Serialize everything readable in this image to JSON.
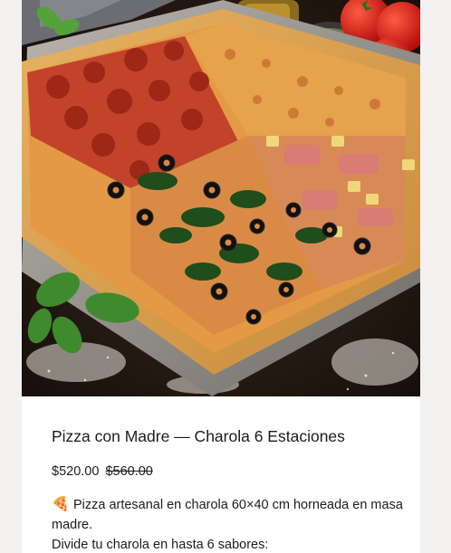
{
  "product": {
    "image_alt": "Pizza en charola con cuatro sabores",
    "title": "Pizza con Madre — Charola 6 Estaciones",
    "price_current": "$520.00",
    "price_original": "$560.00",
    "description_emoji": "🍕",
    "description_line1": "Pizza artesanal en charola 60×40 cm horneada en masa madre.",
    "description_line2": "Divide tu charola en hasta 6 sabores:"
  },
  "colors": {
    "page_background": "#f2f1f0",
    "card_background": "#ffffff",
    "text": "#1c1c1c"
  }
}
